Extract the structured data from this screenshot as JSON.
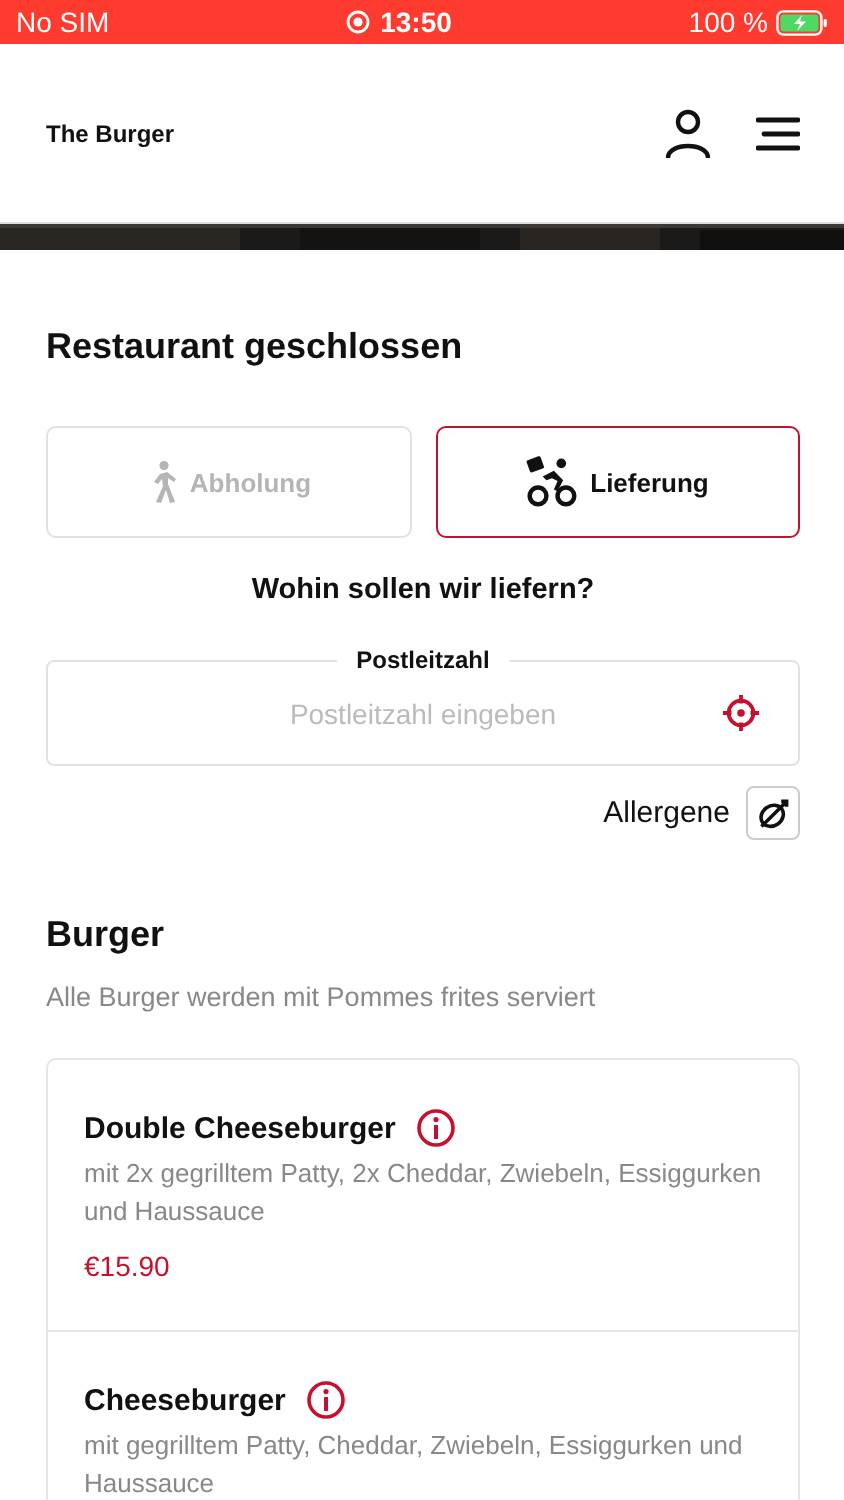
{
  "status_bar": {
    "carrier": "No SIM",
    "time": "13:50",
    "battery": "100 %"
  },
  "header": {
    "title": "The Burger"
  },
  "restaurant_status": "Restaurant geschlossen",
  "order_modes": [
    {
      "kind": "walk",
      "label": "Abholung",
      "selected": false
    },
    {
      "kind": "bike",
      "label": "Lieferung",
      "selected": true
    }
  ],
  "delivery_question": "Wohin sollen wir liefern?",
  "postcode_field": {
    "label": "Postleitzahl",
    "placeholder": "Postleitzahl eingeben"
  },
  "allergens_button": "Allergene",
  "category": {
    "title": "Burger",
    "subtitle": "Alle Burger werden mit Pommes frites serviert",
    "items": [
      {
        "name": "Double Cheeseburger",
        "description": "mit 2x gegrilltem Patty, 2x Cheddar, Zwiebeln, Essiggurken und Haussauce",
        "price": "€15.90"
      },
      {
        "name": "Cheeseburger",
        "description": "mit gegrilltem Patty, Cheddar, Zwiebeln, Essiggurken und Haussauce"
      }
    ]
  }
}
